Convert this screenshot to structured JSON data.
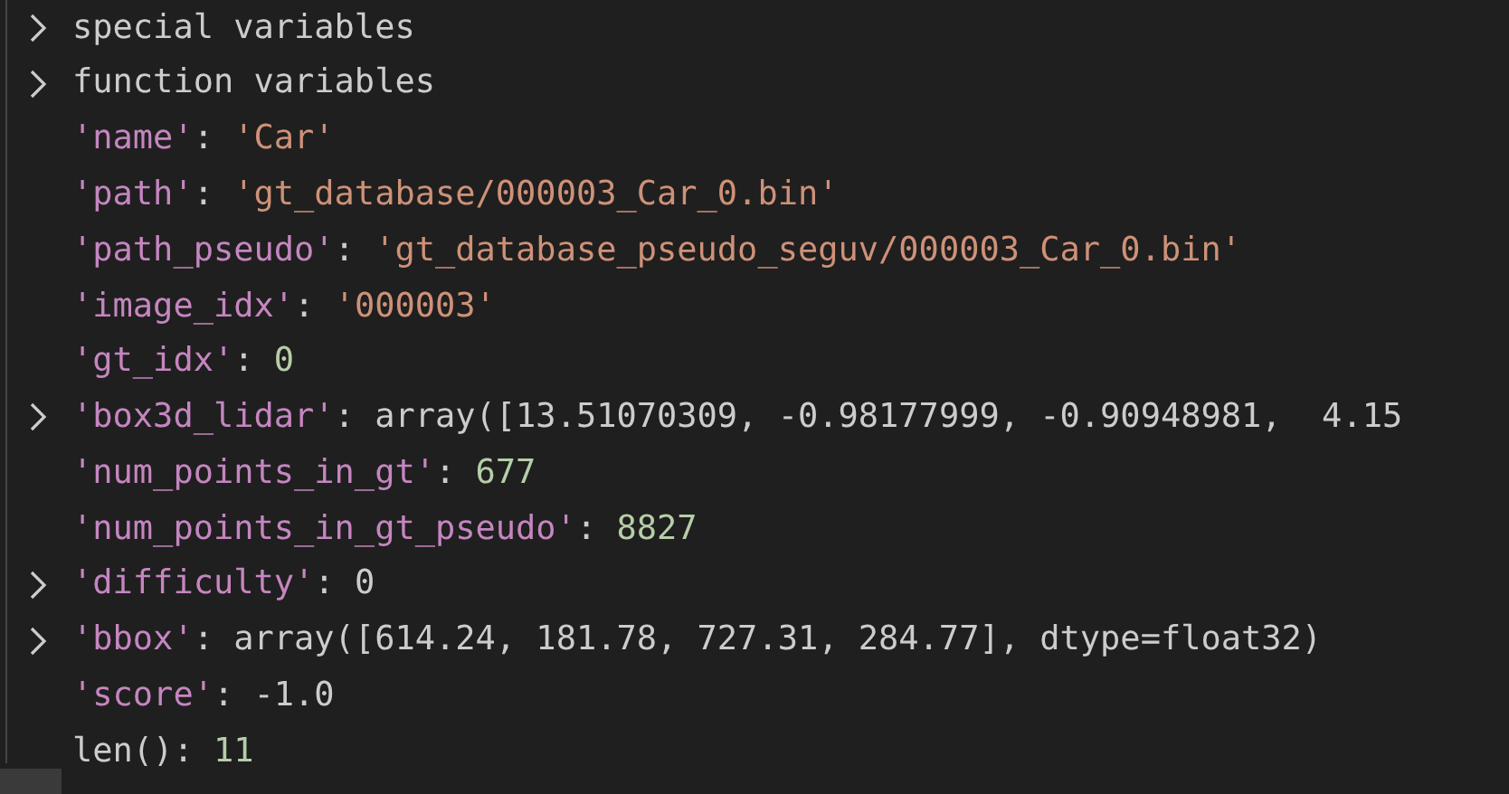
{
  "variables": [
    {
      "expandable": true,
      "parts": [
        {
          "kind": "label",
          "text": "special variables"
        }
      ]
    },
    {
      "expandable": true,
      "parts": [
        {
          "kind": "label",
          "text": "function variables"
        }
      ]
    },
    {
      "expandable": false,
      "parts": [
        {
          "kind": "key",
          "text": "'name'"
        },
        {
          "kind": "punct",
          "text": ": "
        },
        {
          "kind": "string",
          "text": "'Car'"
        }
      ]
    },
    {
      "expandable": false,
      "parts": [
        {
          "kind": "key",
          "text": "'path'"
        },
        {
          "kind": "punct",
          "text": ": "
        },
        {
          "kind": "string",
          "text": "'gt_database/000003_Car_0.bin'"
        }
      ]
    },
    {
      "expandable": false,
      "parts": [
        {
          "kind": "key",
          "text": "'path_pseudo'"
        },
        {
          "kind": "punct",
          "text": ": "
        },
        {
          "kind": "string",
          "text": "'gt_database_pseudo_seguv/000003_Car_0.bin'"
        }
      ]
    },
    {
      "expandable": false,
      "parts": [
        {
          "kind": "key",
          "text": "'image_idx'"
        },
        {
          "kind": "punct",
          "text": ": "
        },
        {
          "kind": "string",
          "text": "'000003'"
        }
      ]
    },
    {
      "expandable": false,
      "parts": [
        {
          "kind": "key",
          "text": "'gt_idx'"
        },
        {
          "kind": "punct",
          "text": ": "
        },
        {
          "kind": "number",
          "text": "0"
        }
      ]
    },
    {
      "expandable": true,
      "parts": [
        {
          "kind": "key",
          "text": "'box3d_lidar'"
        },
        {
          "kind": "punct",
          "text": ": "
        },
        {
          "kind": "label",
          "text": "array([13.51070309, -0.98177999, -0.90948981,  4.15"
        }
      ]
    },
    {
      "expandable": false,
      "parts": [
        {
          "kind": "key",
          "text": "'num_points_in_gt'"
        },
        {
          "kind": "punct",
          "text": ": "
        },
        {
          "kind": "number",
          "text": "677"
        }
      ]
    },
    {
      "expandable": false,
      "parts": [
        {
          "kind": "key",
          "text": "'num_points_in_gt_pseudo'"
        },
        {
          "kind": "punct",
          "text": ": "
        },
        {
          "kind": "number",
          "text": "8827"
        }
      ]
    },
    {
      "expandable": true,
      "parts": [
        {
          "kind": "key",
          "text": "'difficulty'"
        },
        {
          "kind": "punct",
          "text": ": "
        },
        {
          "kind": "label",
          "text": "0"
        }
      ]
    },
    {
      "expandable": true,
      "parts": [
        {
          "kind": "key",
          "text": "'bbox'"
        },
        {
          "kind": "punct",
          "text": ": "
        },
        {
          "kind": "label",
          "text": "array([614.24, 181.78, 727.31, 284.77], dtype=float32)"
        }
      ]
    },
    {
      "expandable": false,
      "parts": [
        {
          "kind": "key",
          "text": "'score'"
        },
        {
          "kind": "punct",
          "text": ": "
        },
        {
          "kind": "label",
          "text": "-1.0"
        }
      ]
    },
    {
      "expandable": false,
      "parts": [
        {
          "kind": "label",
          "text": "len()"
        },
        {
          "kind": "punct",
          "text": ": "
        },
        {
          "kind": "number",
          "text": "11"
        }
      ]
    }
  ]
}
